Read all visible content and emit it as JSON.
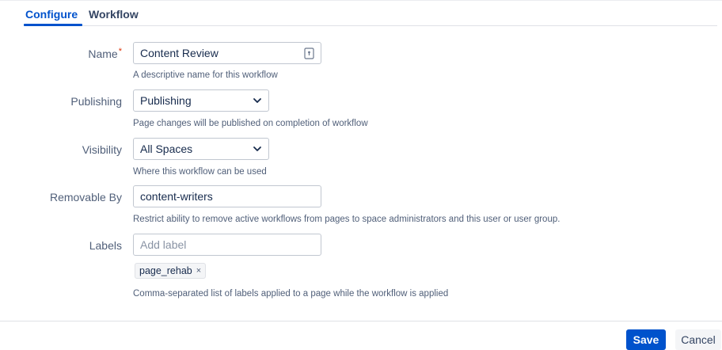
{
  "tabs": [
    {
      "label": "Configure",
      "active": true
    },
    {
      "label": "Workflow",
      "active": false
    }
  ],
  "form": {
    "name": {
      "label": "Name",
      "required_mark": "*",
      "value": "Content Review",
      "help": "A descriptive name for this workflow"
    },
    "publishing": {
      "label": "Publishing",
      "value": "Publishing",
      "help": "Page changes will be published on completion of workflow"
    },
    "visibility": {
      "label": "Visibility",
      "value": "All Spaces",
      "help": "Where this workflow can be used"
    },
    "removable_by": {
      "label": "Removable By",
      "value": "content-writers",
      "help": "Restrict ability to remove active workflows from pages to space administrators and this user or user group."
    },
    "labels": {
      "label": "Labels",
      "placeholder": "Add label",
      "tags": [
        "page_rehab"
      ],
      "tag_remove": "×",
      "help": "Comma-separated list of labels applied to a page while the workflow is applied"
    }
  },
  "actions": {
    "save_label": "Save",
    "cancel_label": "Cancel"
  },
  "colors": {
    "accent": "#0052cc",
    "required": "#de350b",
    "border": "#c1c7d0"
  },
  "icons": {
    "name_field_icon": "lock-icon",
    "select_chevron": "chevron-down-icon"
  }
}
